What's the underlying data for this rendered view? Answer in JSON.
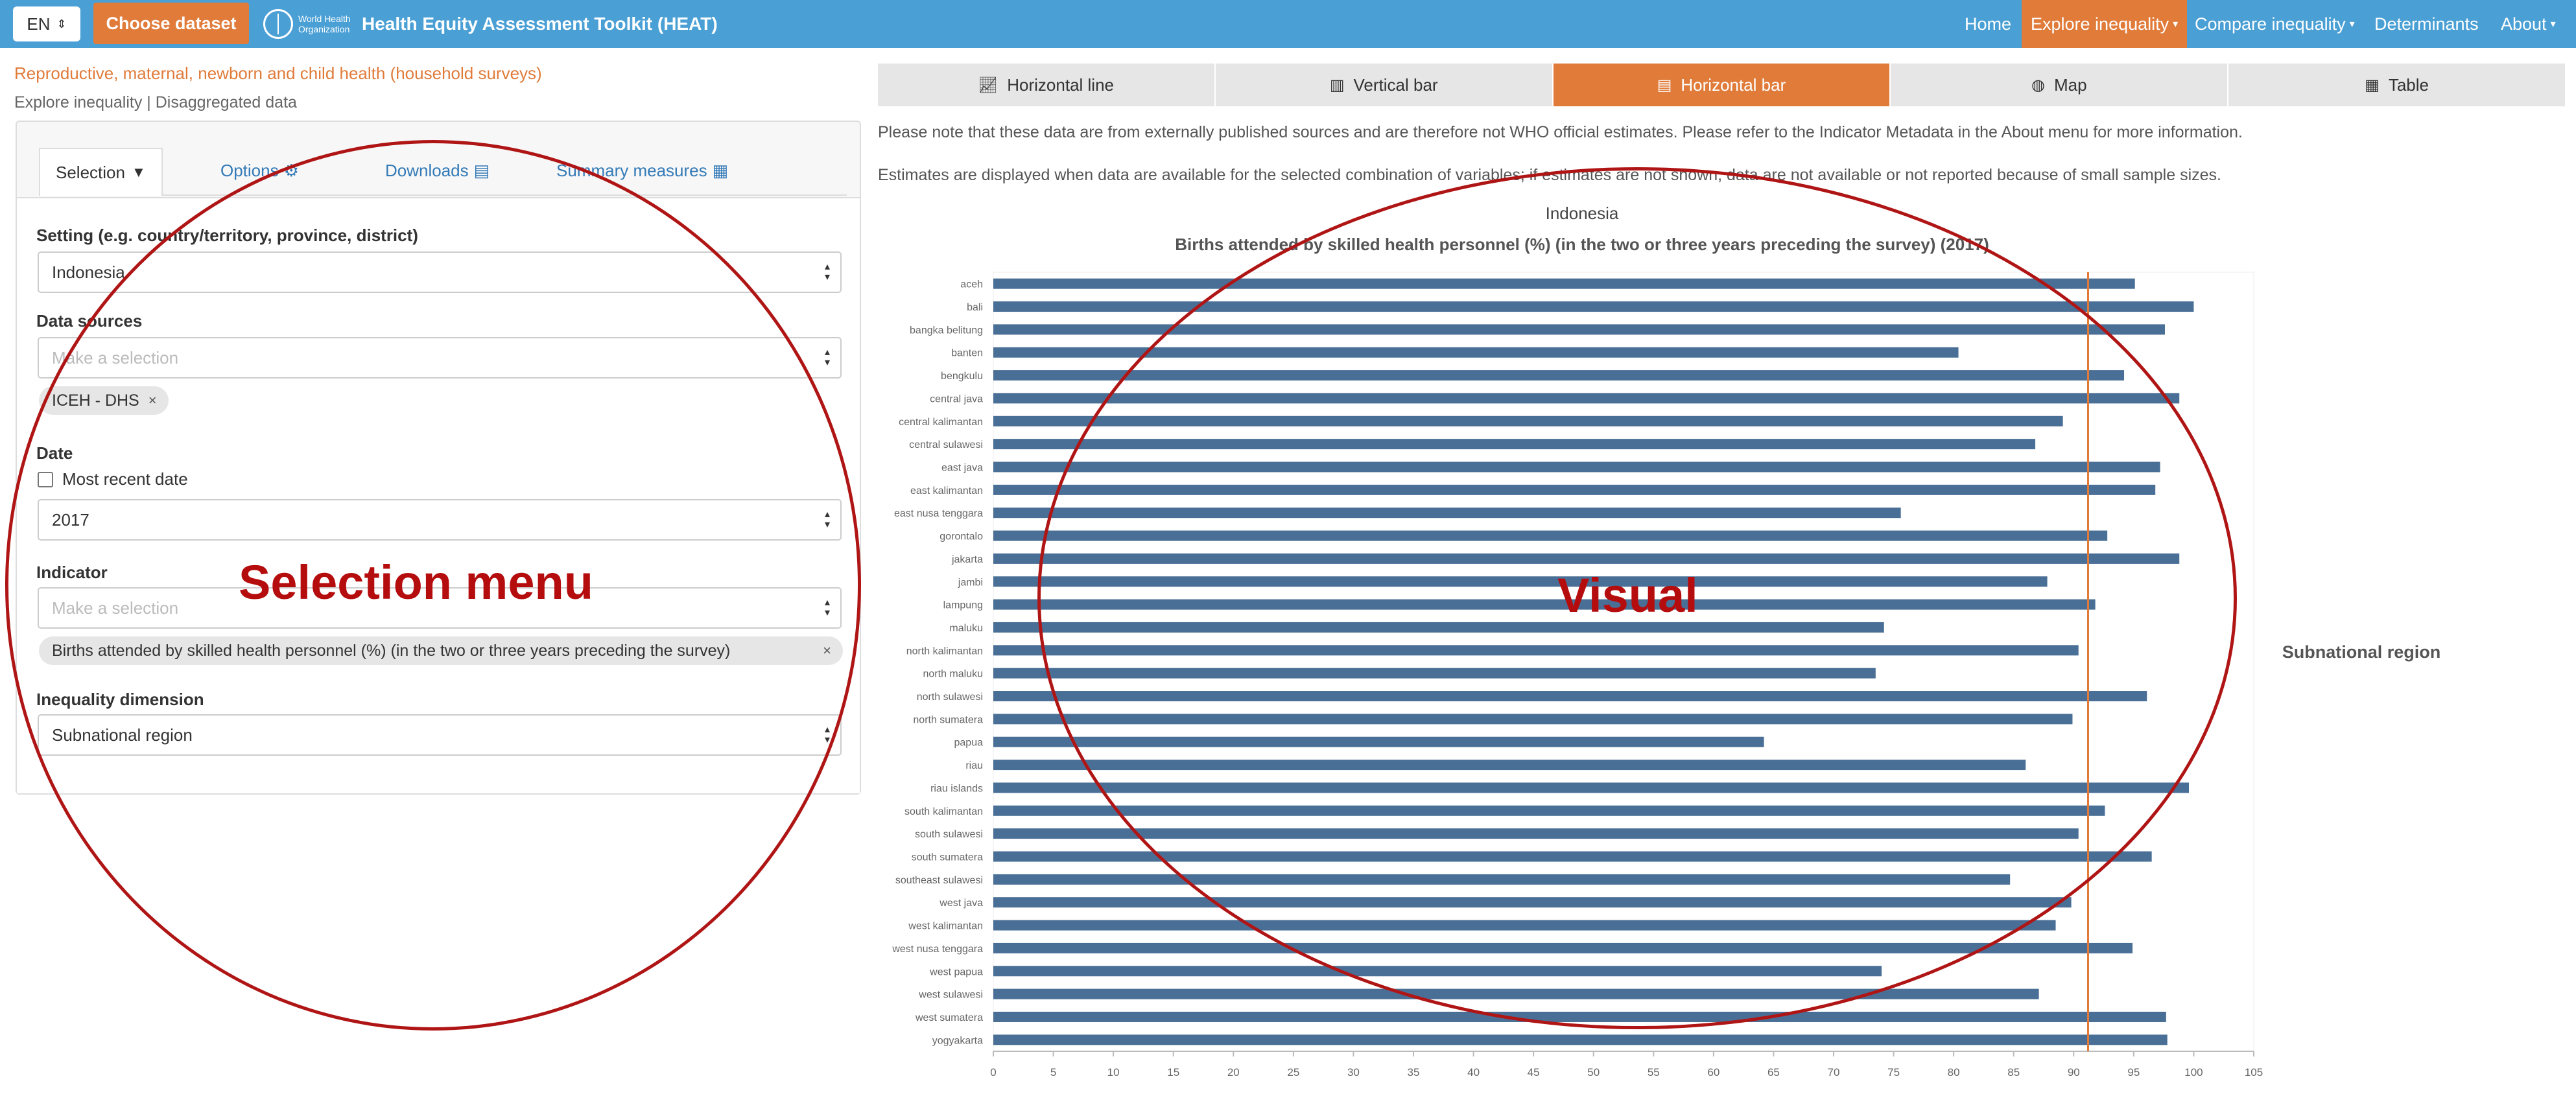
{
  "navbar": {
    "lang": "EN",
    "choose_dataset": "Choose dataset",
    "who_text": "World Health Organization",
    "app_title": "Health Equity Assessment Toolkit (HEAT)",
    "items": [
      "Home",
      "Explore inequality",
      "Compare inequality",
      "Determinants",
      "About"
    ],
    "active_item": "Explore inequality",
    "accent_color": "#e07b3a",
    "bar_color": "#4a9fd5"
  },
  "left": {
    "title": "Reproductive, maternal, newborn and child health (household surveys)",
    "subtitle": "Explore inequality | Disaggregated data",
    "tabs": [
      "Selection",
      "Options",
      "Downloads",
      "Summary measures"
    ],
    "setting_label": "Setting (e.g. country/territory, province, district)",
    "setting_value": "Indonesia",
    "data_sources_label": "Data sources",
    "data_sources_placeholder": "Make a selection",
    "data_source_chip": "ICEH - DHS",
    "date_label": "Date",
    "most_recent_label": "Most recent date",
    "date_value": "2017",
    "indicator_label": "Indicator",
    "indicator_placeholder": "Make a selection",
    "indicator_chip": "Births attended by skilled health personnel (%) (in the two or three years preceding the survey)",
    "dimension_label": "Inequality dimension",
    "dimension_value": "Subnational region",
    "chip_remove": "×"
  },
  "right": {
    "chart_tabs": [
      "Horizontal line",
      "Vertical bar",
      "Horizontal bar",
      "Map",
      "Table"
    ],
    "active_tab": "Horizontal bar",
    "note1": "Please note that these data are from externally published sources and are therefore not WHO official estimates. Please refer to the Indicator Metadata in the About menu for more information.",
    "note2": "Estimates are displayed when data are available for the selected combination of variables; if estimates are not shown, data are not available or not reported because of small sample sizes."
  },
  "annotations": {
    "selection_menu": "Selection menu",
    "visual": "Visual",
    "color": "#b01515"
  },
  "chart_data": {
    "type": "bar",
    "orientation": "horizontal",
    "title": "Indonesia",
    "subtitle": "Births attended by skilled health personnel (%) (in the two or three years preceding the survey) (2017)",
    "panel_label": "Subnational region",
    "bar_color": "#4a6f96",
    "reference_line": {
      "value": 91.2,
      "color": "#e07b3a"
    },
    "xlim": [
      0,
      105
    ],
    "xticks": [
      0,
      5,
      10,
      15,
      20,
      25,
      30,
      35,
      40,
      45,
      50,
      55,
      60,
      65,
      70,
      75,
      80,
      85,
      90,
      95,
      100,
      105
    ],
    "categories": [
      "aceh",
      "bali",
      "bangka belitung",
      "banten",
      "bengkulu",
      "central java",
      "central kalimantan",
      "central sulawesi",
      "east java",
      "east kalimantan",
      "east nusa tenggara",
      "gorontalo",
      "jakarta",
      "jambi",
      "lampung",
      "maluku",
      "north kalimantan",
      "north maluku",
      "north sulawesi",
      "north sumatera",
      "papua",
      "riau",
      "riau islands",
      "south kalimantan",
      "south sulawesi",
      "south sumatera",
      "southeast sulawesi",
      "west java",
      "west kalimantan",
      "west nusa tenggara",
      "west papua",
      "west sulawesi",
      "west sumatera",
      "yogyakarta"
    ],
    "values": [
      95.1,
      100,
      97.6,
      80.4,
      94.2,
      98.8,
      89.1,
      86.8,
      97.2,
      96.8,
      75.6,
      92.8,
      98.8,
      87.8,
      91.8,
      74.2,
      90.4,
      73.5,
      96.1,
      89.9,
      64.2,
      86.0,
      99.6,
      92.6,
      90.4,
      96.5,
      84.7,
      89.8,
      88.5,
      94.9,
      74.0,
      87.1,
      97.7,
      97.8
    ]
  }
}
